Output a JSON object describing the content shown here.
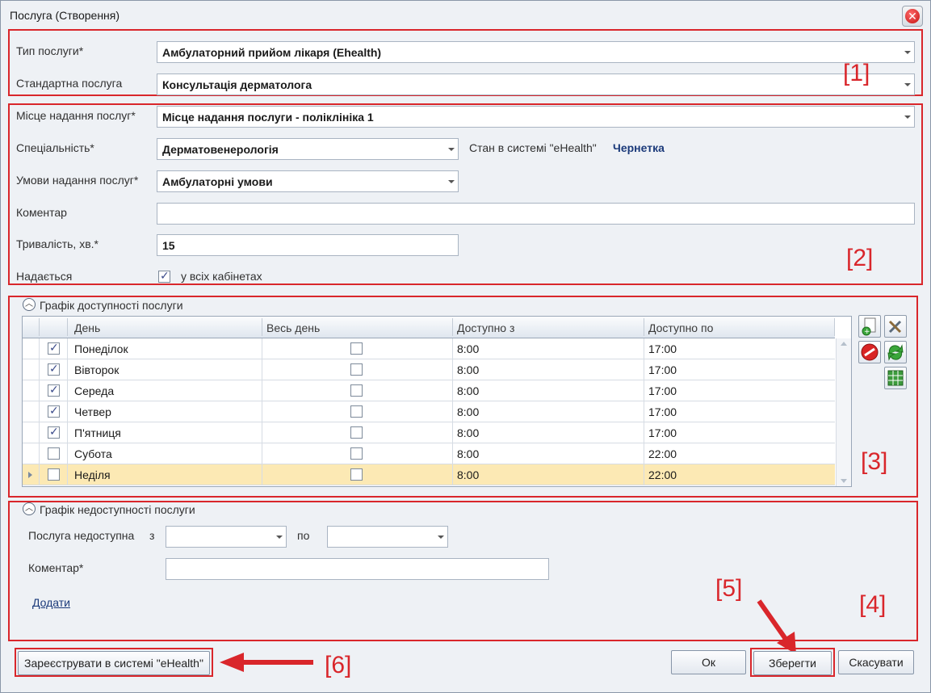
{
  "window": {
    "title": "Послуга (Створення)"
  },
  "service_type": {
    "label": "Тип послуги*",
    "value": "Амбулаторний прийом лікаря (Ehealth)"
  },
  "standard_service": {
    "label": "Стандартна послуга",
    "value": "Консультація дерматолога"
  },
  "place": {
    "label": "Місце надання послуг*",
    "value": "Місце надання послуги - поліклініка 1"
  },
  "specialty": {
    "label": "Спеціальність*",
    "value": "Дерматовенерологія"
  },
  "ehealth_status": {
    "label": "Стан в системі \"eHealth\"",
    "value": "Чернетка"
  },
  "conditions": {
    "label": "Умови надання послуг*",
    "value": "Амбулаторні умови"
  },
  "comment": {
    "label": "Коментар",
    "value": ""
  },
  "duration": {
    "label": "Тривалість, хв.*",
    "value": "15"
  },
  "provided": {
    "label": "Надається",
    "checkbox_label": "у всіх кабінетах",
    "checked": true
  },
  "availability": {
    "title": "Графік доступності послуги",
    "columns": [
      "День",
      "Весь день",
      "Доступно з",
      "Доступно по"
    ],
    "rows": [
      {
        "checked": true,
        "day": "Понеділок",
        "all_day": false,
        "from": "8:00",
        "to": "17:00"
      },
      {
        "checked": true,
        "day": "Вівторок",
        "all_day": false,
        "from": "8:00",
        "to": "17:00"
      },
      {
        "checked": true,
        "day": "Середа",
        "all_day": false,
        "from": "8:00",
        "to": "17:00"
      },
      {
        "checked": true,
        "day": "Четвер",
        "all_day": false,
        "from": "8:00",
        "to": "17:00"
      },
      {
        "checked": true,
        "day": "П'ятниця",
        "all_day": false,
        "from": "8:00",
        "to": "17:00"
      },
      {
        "checked": false,
        "day": "Субота",
        "all_day": false,
        "from": "8:00",
        "to": "22:00"
      },
      {
        "checked": false,
        "day": "Неділя",
        "all_day": false,
        "from": "8:00",
        "to": "22:00",
        "selected": true
      }
    ]
  },
  "unavailability": {
    "title": "Графік недоступності послуги",
    "unavailable_label": "Послуга недоступна",
    "from_label": "з",
    "to_label": "по",
    "comment_label": "Коментар*",
    "add_link": "Додати"
  },
  "buttons": {
    "register": "Зареєструвати в системі \"eHealth\"",
    "ok": "Ок",
    "save": "Зберегти",
    "cancel": "Скасувати"
  },
  "annotations": [
    "[1]",
    "[2]",
    "[3]",
    "[4]",
    "[5]",
    "[6]"
  ],
  "colors": {
    "annotation": "#d9262b",
    "selected_row": "#fce9b4",
    "status": "#1b3a7a"
  }
}
